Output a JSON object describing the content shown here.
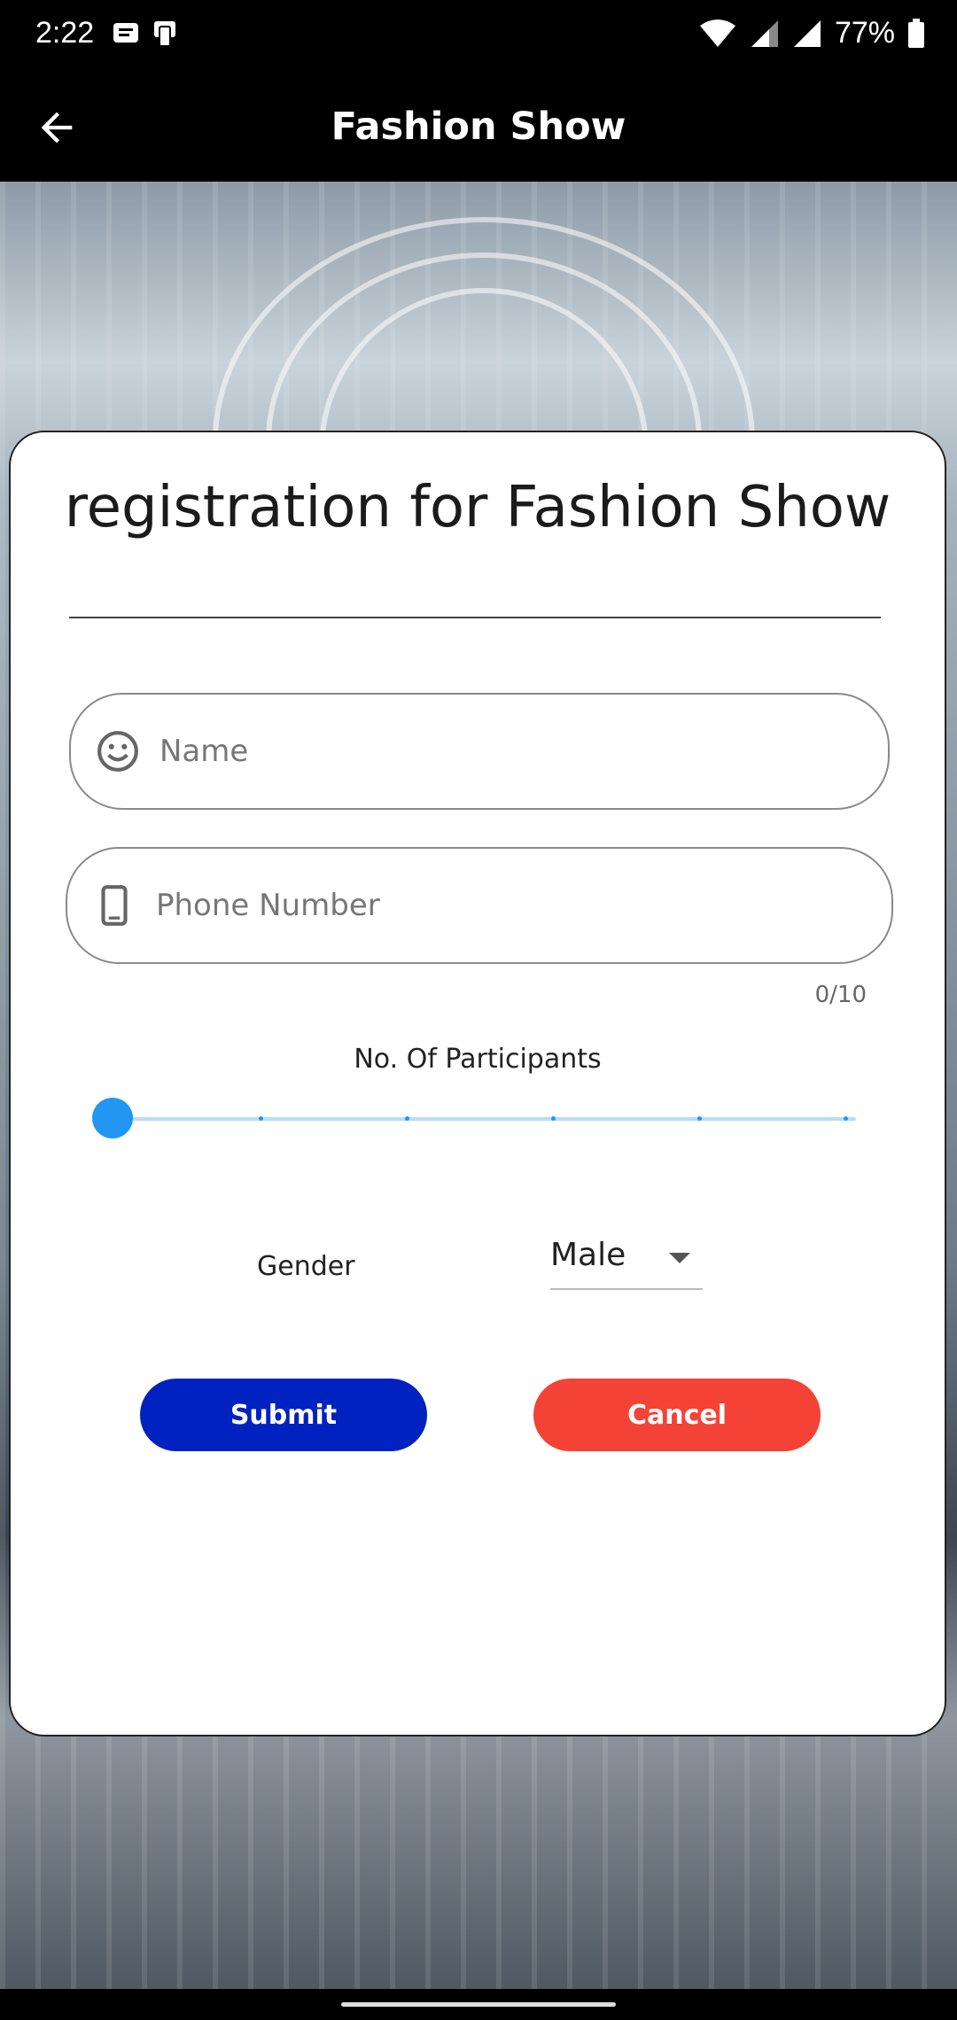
{
  "status_bar": {
    "time": "2:22",
    "battery": "77%"
  },
  "app_bar": {
    "title": "Fashion Show"
  },
  "form": {
    "title": "registration for Fashion Show",
    "name_placeholder": "Name",
    "phone_placeholder": "Phone Number",
    "phone_counter": "0/10",
    "participants_label": "No. Of Participants",
    "participants_value": 0,
    "gender_label": "Gender",
    "gender_value": "Male",
    "submit_label": "Submit",
    "cancel_label": "Cancel"
  },
  "colors": {
    "submit": "#0022c0",
    "cancel": "#f44336",
    "slider": "#2196f3"
  },
  "icons": {
    "name_field": "smiley-face-icon",
    "phone_field": "smartphone-icon",
    "back": "arrow-back-icon"
  }
}
